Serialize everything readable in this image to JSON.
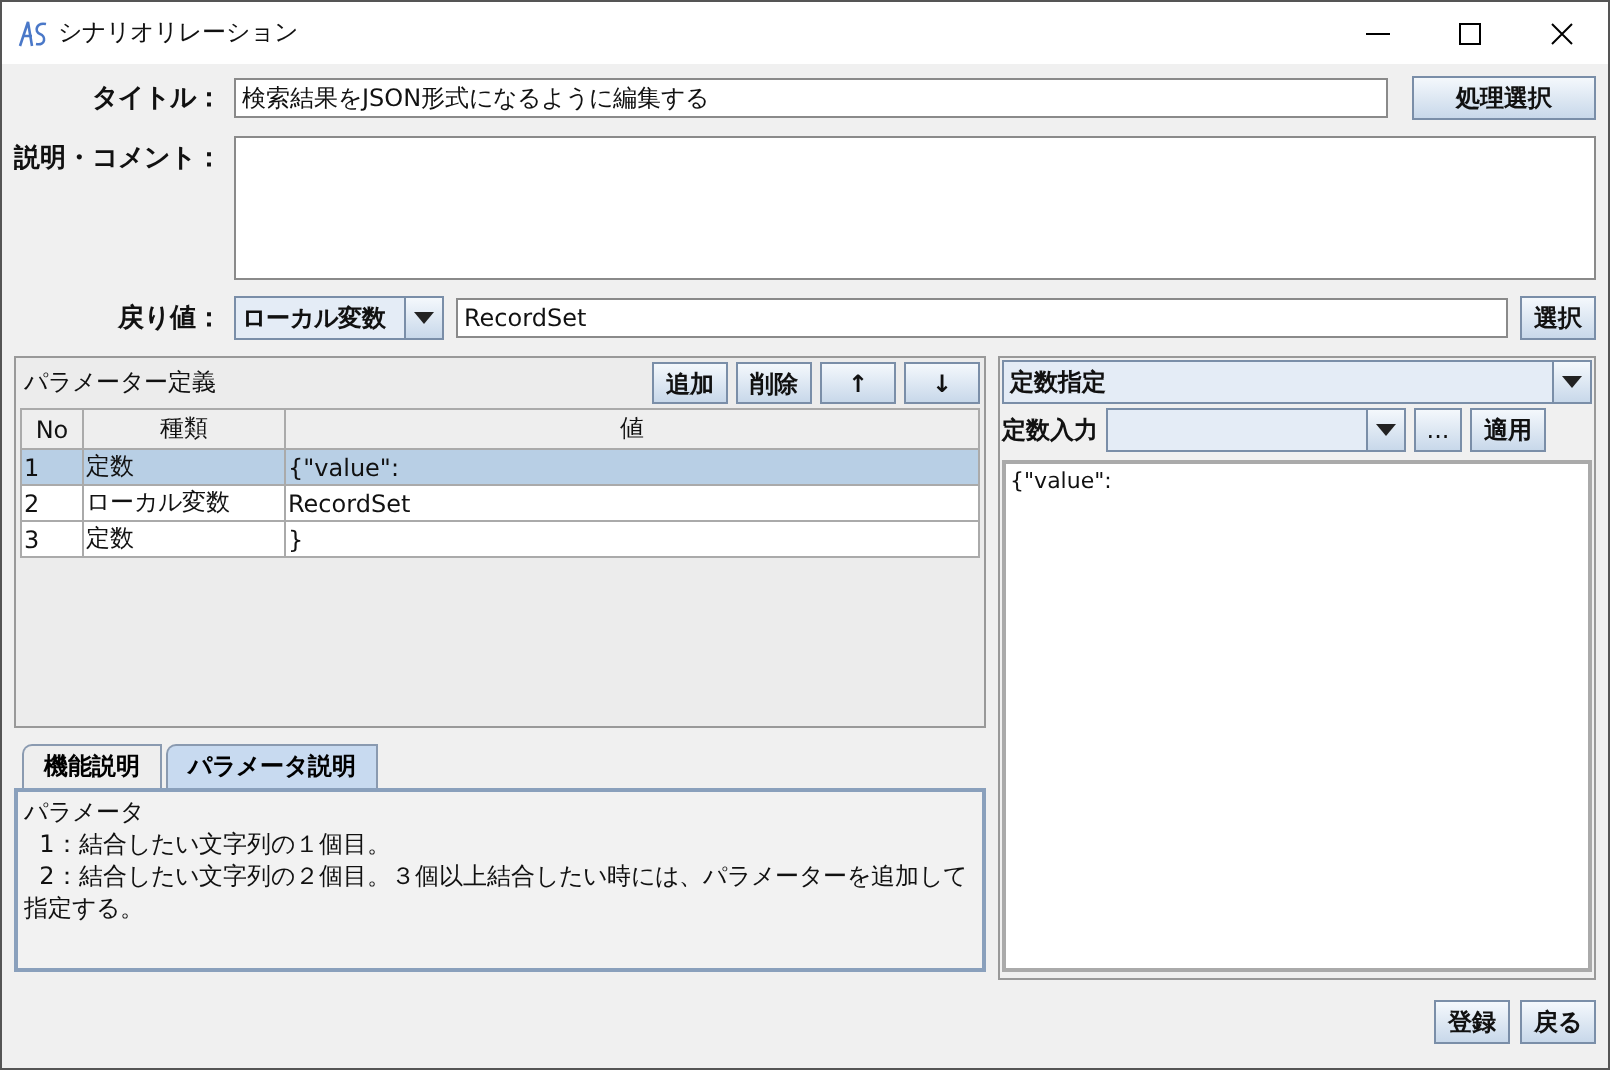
{
  "window": {
    "title": "シナリオリレーション"
  },
  "form": {
    "title_label": "タイトル：",
    "title_value": "検索結果をJSON形式になるように編集する",
    "process_button": "処理選択",
    "comment_label": "説明・コメント：",
    "return_label": "戻り値：",
    "return_type": "ローカル変数",
    "return_value": "RecordSet",
    "select_button": "選択"
  },
  "parameters": {
    "title": "パラメーター定義",
    "buttons": [
      "追加",
      "削除",
      "↑",
      "↓"
    ],
    "columns": [
      "No",
      "種類",
      "値"
    ],
    "rows": [
      {
        "no": "1",
        "type": "定数",
        "value": "{\"value\":",
        "selected": true
      },
      {
        "no": "2",
        "type": "ローカル変数",
        "value": "RecordSet",
        "selected": false
      },
      {
        "no": "3",
        "type": "定数",
        "value": "}",
        "selected": false
      }
    ]
  },
  "help": {
    "tabs": [
      {
        "label": "機能説明",
        "selected": false
      },
      {
        "label": "パラメータ説明",
        "selected": true
      }
    ],
    "text": "パラメータ\n  1：結合したい文字列の１個目。\n  2：結合したい文字列の２個目。３個以上結合したい時には、パラメーターを追加して指定する。"
  },
  "constant": {
    "mode": "定数指定",
    "input_label": "定数入力",
    "more_button": "...",
    "apply_button": "適用",
    "text": "{\"value\":"
  },
  "footer_buttons": [
    "登録",
    "戻る"
  ]
}
